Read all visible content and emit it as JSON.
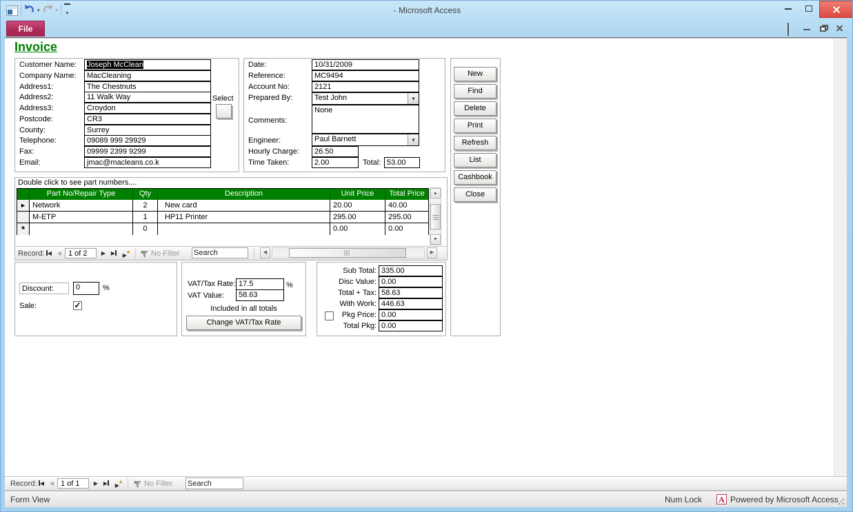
{
  "titlebar": {
    "title": "- Microsoft Access"
  },
  "ribbon": {
    "file_tab": "File"
  },
  "icons": {
    "prev_arrow": "◀",
    "next_arrow": "▶",
    "up_arrow": "▲",
    "down_arrow": "▼",
    "dropdown_arrow": "▾",
    "checkmark": "✓",
    "current_row_marker": "►",
    "new_row_marker": "*",
    "new_record_star": "*"
  },
  "colors": {
    "table_header_green": "#008000",
    "invoice_title_green": "#008000",
    "file_tab_magenta": "#B02A58",
    "close_button_red": "#DD4A40",
    "titlebar_blue": "#B9DDF4"
  },
  "invoice": {
    "title": "Invoice",
    "customer": {
      "fields": [
        {
          "label": "Customer Name:",
          "value": "Joseph McClean"
        },
        {
          "label": "Company Name:",
          "value": "MacCleaning"
        },
        {
          "label": "Address1:",
          "value": "The Chestnuts"
        },
        {
          "label": "Address2:",
          "value": "11 Walk Way"
        },
        {
          "label": "Address3:",
          "value": "Croydon"
        },
        {
          "label": "Postcode:",
          "value": "CR3"
        },
        {
          "label": "County:",
          "value": "Surrey"
        },
        {
          "label": "Telephone:",
          "value": "09089 999 29929"
        },
        {
          "label": "Fax:",
          "value": "09999 2399 9299"
        },
        {
          "label": "Email:",
          "value": "jmac@macleans.co.k"
        }
      ],
      "select_label": "Select"
    },
    "details": {
      "date": {
        "label": "Date:",
        "value": "10/31/2009"
      },
      "reference": {
        "label": "Reference:",
        "value": "MC9494"
      },
      "account_no": {
        "label": "Account No:",
        "value": "2121"
      },
      "prepared_by": {
        "label": "Prepared By:",
        "value": "Test John"
      },
      "comments": {
        "label": "Comments:",
        "value": "None"
      },
      "engineer": {
        "label": "Engineer:",
        "value": "Paul Barnett"
      },
      "hourly_charge": {
        "label": "Hourly Charge:",
        "value": "26.50"
      },
      "time_taken": {
        "label": "Time Taken:",
        "value": "2.00"
      },
      "total": {
        "label": "Total:",
        "value": "53.00"
      }
    },
    "actions": [
      "New",
      "Find",
      "Delete",
      "Print",
      "Refresh",
      "List",
      "Cashbook",
      "Close"
    ],
    "parts": {
      "hint": "Double click to see part numbers....",
      "columns": [
        "Part No/Repair Type",
        "Qty",
        "Description",
        "Unit Price",
        "Total Price"
      ],
      "rows": [
        {
          "part": "Network",
          "qty": "2",
          "description": "New card",
          "unit_price": "20.00",
          "total_price": "40.00"
        },
        {
          "part": "M-ETP",
          "qty": "1",
          "description": "HP11 Printer",
          "unit_price": "295.00",
          "total_price": "295.00"
        },
        {
          "part": "",
          "qty": "0",
          "description": "",
          "unit_price": "0.00",
          "total_price": "0.00"
        }
      ],
      "nav": {
        "record_label": "Record:",
        "position": "1 of 2",
        "no_filter": "No Filter",
        "search_placeholder": "Search"
      }
    },
    "discount": {
      "label": "Discount:",
      "value": "0",
      "percent": "%",
      "sale_label": "Sale:"
    },
    "vat": {
      "rate_label": "VAT/Tax Rate:",
      "rate": "17.5",
      "percent": "%",
      "value_label": "VAT Value:",
      "value": "58.63",
      "note": "Included in all totals",
      "change_button": "Change VAT/Tax Rate"
    },
    "totals": {
      "rows": [
        {
          "label": "Sub Total:",
          "value": "335.00"
        },
        {
          "label": "Disc Value:",
          "value": "0.00"
        },
        {
          "label": "Total + Tax:",
          "value": "58.63"
        },
        {
          "label": "With Work:",
          "value": "446.63"
        },
        {
          "label": "Pkg Price:",
          "value": "0.00"
        },
        {
          "label": "Total Pkg:",
          "value": "0.00"
        }
      ]
    }
  },
  "record_nav_bottom": {
    "record_label": "Record:",
    "position": "1 of 1",
    "no_filter": "No Filter",
    "search_placeholder": "Search"
  },
  "statusbar": {
    "view": "Form View",
    "num_lock": "Num Lock",
    "powered_by": "Powered by Microsoft Access"
  }
}
